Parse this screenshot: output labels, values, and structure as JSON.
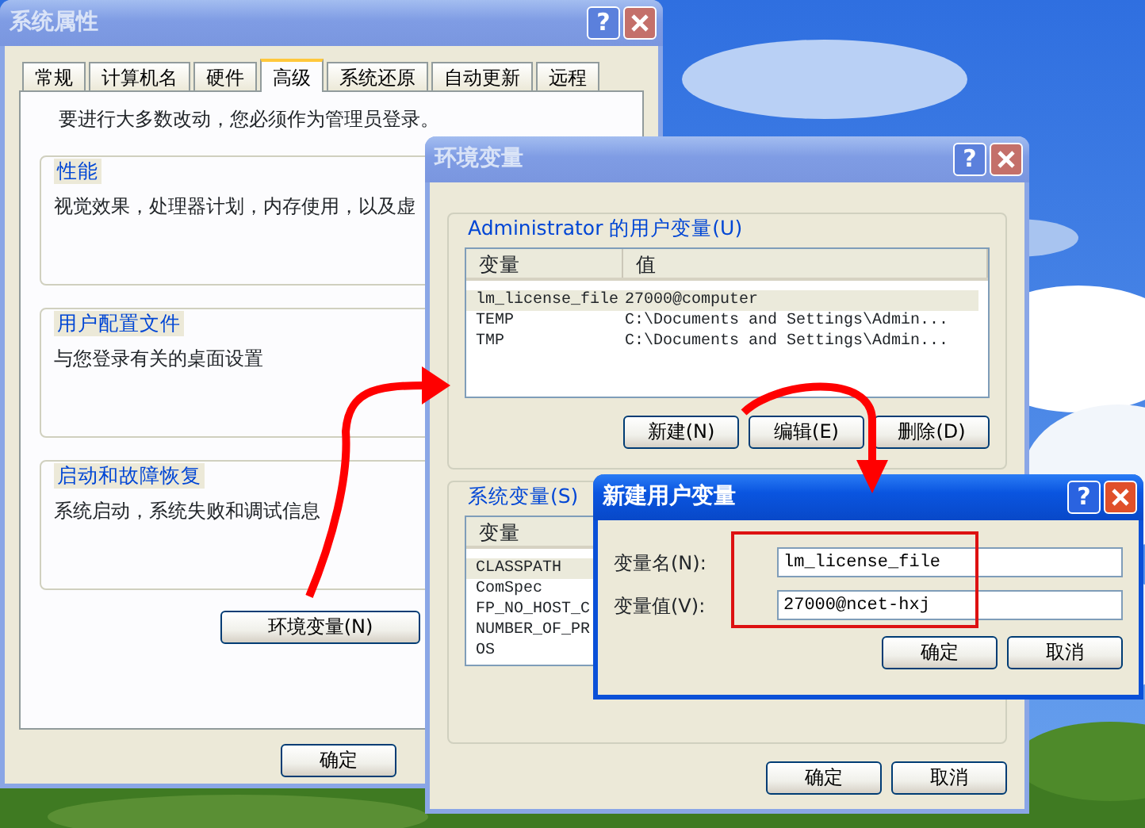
{
  "windows": [
    {
      "kind": "system_properties",
      "title": "系统属性",
      "active": false,
      "help": "?",
      "tabs": [
        {
          "label": "常规",
          "selected": false
        },
        {
          "label": "计算机名",
          "selected": false
        },
        {
          "label": "硬件",
          "selected": false
        },
        {
          "label": "高级",
          "selected": true
        },
        {
          "label": "系统还原",
          "selected": false
        },
        {
          "label": "自动更新",
          "selected": false
        },
        {
          "label": "远程",
          "selected": false
        }
      ],
      "notice": "要进行大多数改动，您必须作为管理员登录。",
      "groups": [
        {
          "title": "性能",
          "text": "视觉效果，处理器计划，内存使用，以及虚"
        },
        {
          "title": "用户配置文件",
          "text": "与您登录有关的桌面设置"
        },
        {
          "title": "启动和故障恢复",
          "text": "系统启动，系统失败和调试信息"
        }
      ],
      "env_button": "环境变量(N)",
      "ok_button": "确定"
    },
    {
      "kind": "environment_variables",
      "title": "环境变量",
      "active": false,
      "help": "?",
      "user_group": {
        "title": "Administrator 的用户变量(U)",
        "columns": [
          "变量",
          "值"
        ],
        "rows": [
          {
            "variable": "lm_license_file",
            "value": "27000@computer",
            "selected": true
          },
          {
            "variable": "TEMP",
            "value": "C:\\Documents and Settings\\Admin...",
            "selected": false
          },
          {
            "variable": "TMP",
            "value": "C:\\Documents and Settings\\Admin...",
            "selected": false
          }
        ],
        "buttons": [
          "新建(N)",
          "编辑(E)",
          "删除(D)"
        ]
      },
      "system_group": {
        "title": "系统变量(S)",
        "columns": [
          "变量"
        ],
        "rows": [
          {
            "variable": "CLASSPATH",
            "selected": true
          },
          {
            "variable": "ComSpec",
            "selected": false
          },
          {
            "variable": "FP_NO_HOST_C",
            "selected": false
          },
          {
            "variable": "NUMBER_OF_PR",
            "selected": false
          },
          {
            "variable": "OS",
            "selected": false
          }
        ]
      },
      "buttons": [
        "确定",
        "取消"
      ]
    },
    {
      "kind": "new_variable",
      "title": "新建用户变量",
      "active": true,
      "help": "?",
      "fields": [
        {
          "label": "变量名(N):",
          "value": "lm_license_file"
        },
        {
          "label": "变量值(V):",
          "value": "27000@ncet-hxj"
        }
      ],
      "buttons": [
        "确定",
        "取消"
      ]
    }
  ]
}
